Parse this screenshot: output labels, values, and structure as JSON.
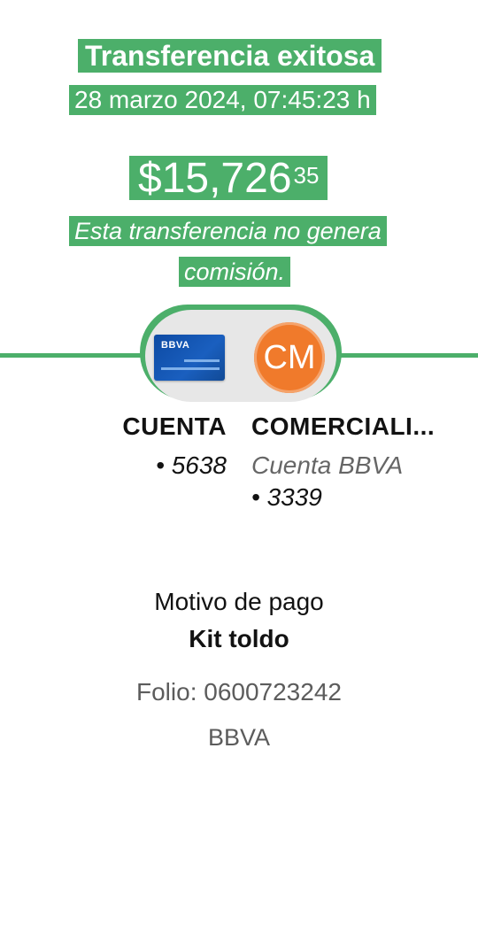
{
  "header": {
    "title": "Transferencia exitosa",
    "datetime": "28 marzo 2024, 07:45:23 h"
  },
  "amount": {
    "main": "$15,726",
    "cents": "35"
  },
  "note": {
    "line1": "Esta transferencia no genera",
    "line2": "comisión."
  },
  "from_account": {
    "card_brand": "BBVA",
    "label": "CUENTA",
    "number": "• 5638"
  },
  "to_account": {
    "initials": "CM",
    "label": "COMERCIALI...",
    "bank": "Cuenta BBVA",
    "number": "• 3339"
  },
  "details": {
    "motivo_label": "Motivo de pago",
    "motivo_value": "Kit toldo",
    "folio": "Folio: 0600723242",
    "bank": "BBVA"
  },
  "colors": {
    "accent_green": "#4caf6a",
    "avatar_orange": "#f07a2b",
    "card_blue": "#0d4aa3"
  }
}
